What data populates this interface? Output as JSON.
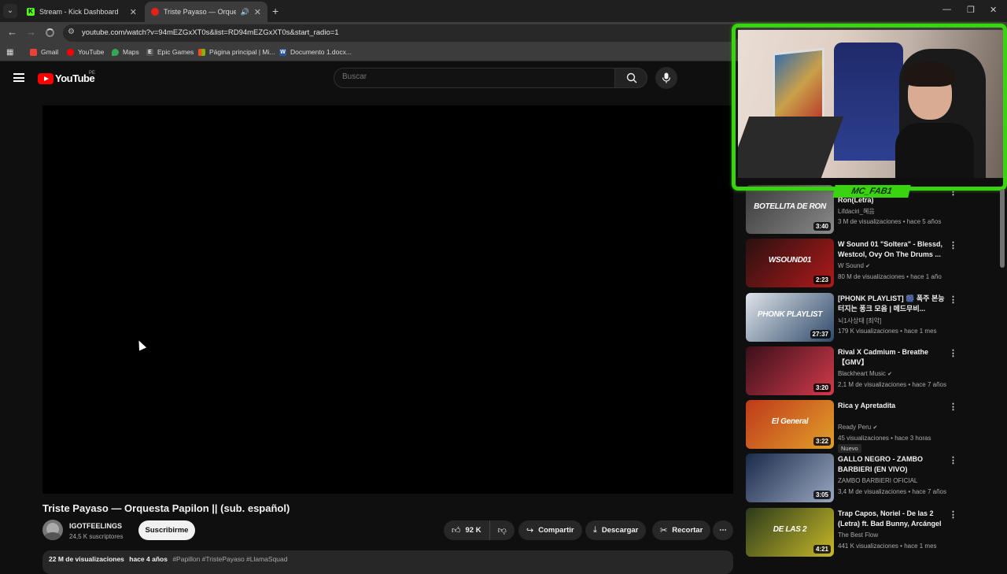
{
  "browser": {
    "tabs": [
      {
        "title": "Stream - Kick Dashboard",
        "favicon_color": "#53fc18"
      },
      {
        "title": "Triste Payaso — Orquesta P",
        "favicon_color": "#e62117"
      }
    ],
    "url": "youtube.com/watch?v=94mEZGxXT0s&list=RD94mEZGxXT0s&start_radio=1",
    "bookmarks": [
      {
        "label": "Gmail",
        "color": "#ea4335"
      },
      {
        "label": "YouTube",
        "color": "#ff0000"
      },
      {
        "label": "Maps",
        "color": "#34a853"
      },
      {
        "label": "Epic Games",
        "color": "#cccccc"
      },
      {
        "label": "Página principal | Mi...",
        "color": "#f25022"
      },
      {
        "label": "Documento 1.docx...",
        "color": "#2b579a"
      }
    ]
  },
  "youtube": {
    "logo_text": "YouTube",
    "country_code": "PE",
    "search_placeholder": "Buscar"
  },
  "video": {
    "title": "Triste Payaso — Orquesta Papilon || (sub. español)",
    "channel": "IGOTFEELINGS",
    "subscribers": "24,5 K suscriptores",
    "subscribe_label": "Suscribirme",
    "likes": "92 K",
    "share_label": "Compartir",
    "download_label": "Descargar",
    "clip_label": "Recortar",
    "views": "22 M de visualizaciones",
    "age": "hace 4 años",
    "hashtags": "#Papillon #TristePayaso #LlamaSquad"
  },
  "webcam": {
    "name": "MC_FAB1"
  },
  "recommendations": [
    {
      "title": "Ron(Letra)",
      "channel": "Lifdaciri_혜음",
      "views": "3 M de visualizaciones",
      "age": "hace 5 años",
      "duration": "3:40",
      "thumb_text": "BOTELLITA DE RON",
      "thumb_colors": [
        "#3a3a3a",
        "#8a8a8a"
      ],
      "verified": false
    },
    {
      "title": "W Sound 01 \"Soltera\" - Blessd, Westcol, Ovy On The Drums ...",
      "channel": "W Sound",
      "views": "80 M de visualizaciones",
      "age": "hace 1 año",
      "duration": "2:23",
      "thumb_text": "WSOUND01",
      "thumb_colors": [
        "#2a1010",
        "#b01a1a"
      ],
      "verified": true
    },
    {
      "title": "[PHONK PLAYLIST] 🎆 폭주 본능 터지는 퐁크 모음 | 메드무비...",
      "channel": "뇌1사상태 [최악]",
      "views": "179 K visualizaciones",
      "age": "hace 1 mes",
      "duration": "27:37",
      "thumb_text": "PHONK PLAYLIST",
      "thumb_colors": [
        "#dfe4ea",
        "#2f4a6a"
      ],
      "verified": false
    },
    {
      "title": "Rival X Cadmium - Breathe【GMV】",
      "channel": "Blackheart Music",
      "views": "2,1 M de visualizaciones",
      "age": "hace 7 años",
      "duration": "3:20",
      "thumb_text": "",
      "thumb_colors": [
        "#3a0f1a",
        "#d23a4a"
      ],
      "verified": true
    },
    {
      "title": "Rica y Apretadita",
      "channel": "Ready Peru",
      "views": "45 visualizaciones",
      "age": "hace 3 horas",
      "duration": "3:22",
      "thumb_text": "El General",
      "thumb_colors": [
        "#c0391b",
        "#e0a02a"
      ],
      "verified": true,
      "badge": "Nuevo"
    },
    {
      "title": "GALLO NEGRO - ZAMBO BARBIERI (EN VIVO)",
      "channel": "ZAMBO BARBIERI OFICIAL",
      "views": "3,4 M de visualizaciones",
      "age": "hace 7 años",
      "duration": "3:05",
      "thumb_text": "",
      "thumb_colors": [
        "#1a2a4a",
        "#9aa8c0"
      ],
      "verified": false
    },
    {
      "title": "Trap Capos, Noriel - De las 2 (Letra) ft. Bad Bunny, Arcángel",
      "channel": "The Best Flow",
      "views": "441 K visualizaciones",
      "age": "hace 1 mes",
      "duration": "4:21",
      "thumb_text": "DE LAS 2",
      "thumb_colors": [
        "#2a3a1a",
        "#c8b82a"
      ],
      "verified": false
    }
  ]
}
